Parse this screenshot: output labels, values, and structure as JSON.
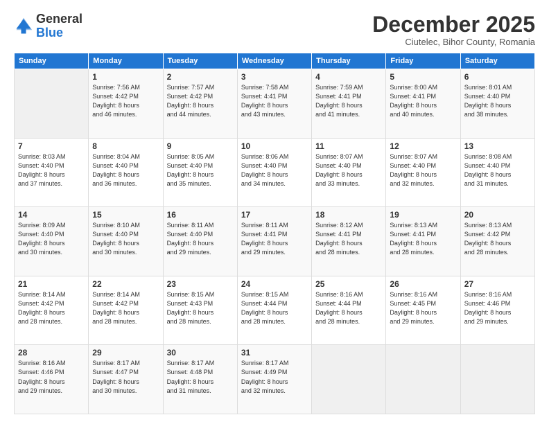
{
  "header": {
    "logo_general": "General",
    "logo_blue": "Blue",
    "month_title": "December 2025",
    "location": "Ciutelec, Bihor County, Romania"
  },
  "days_of_week": [
    "Sunday",
    "Monday",
    "Tuesday",
    "Wednesday",
    "Thursday",
    "Friday",
    "Saturday"
  ],
  "weeks": [
    [
      {
        "day": "",
        "info": ""
      },
      {
        "day": "1",
        "info": "Sunrise: 7:56 AM\nSunset: 4:42 PM\nDaylight: 8 hours\nand 46 minutes."
      },
      {
        "day": "2",
        "info": "Sunrise: 7:57 AM\nSunset: 4:42 PM\nDaylight: 8 hours\nand 44 minutes."
      },
      {
        "day": "3",
        "info": "Sunrise: 7:58 AM\nSunset: 4:41 PM\nDaylight: 8 hours\nand 43 minutes."
      },
      {
        "day": "4",
        "info": "Sunrise: 7:59 AM\nSunset: 4:41 PM\nDaylight: 8 hours\nand 41 minutes."
      },
      {
        "day": "5",
        "info": "Sunrise: 8:00 AM\nSunset: 4:41 PM\nDaylight: 8 hours\nand 40 minutes."
      },
      {
        "day": "6",
        "info": "Sunrise: 8:01 AM\nSunset: 4:40 PM\nDaylight: 8 hours\nand 38 minutes."
      }
    ],
    [
      {
        "day": "7",
        "info": "Sunrise: 8:03 AM\nSunset: 4:40 PM\nDaylight: 8 hours\nand 37 minutes."
      },
      {
        "day": "8",
        "info": "Sunrise: 8:04 AM\nSunset: 4:40 PM\nDaylight: 8 hours\nand 36 minutes."
      },
      {
        "day": "9",
        "info": "Sunrise: 8:05 AM\nSunset: 4:40 PM\nDaylight: 8 hours\nand 35 minutes."
      },
      {
        "day": "10",
        "info": "Sunrise: 8:06 AM\nSunset: 4:40 PM\nDaylight: 8 hours\nand 34 minutes."
      },
      {
        "day": "11",
        "info": "Sunrise: 8:07 AM\nSunset: 4:40 PM\nDaylight: 8 hours\nand 33 minutes."
      },
      {
        "day": "12",
        "info": "Sunrise: 8:07 AM\nSunset: 4:40 PM\nDaylight: 8 hours\nand 32 minutes."
      },
      {
        "day": "13",
        "info": "Sunrise: 8:08 AM\nSunset: 4:40 PM\nDaylight: 8 hours\nand 31 minutes."
      }
    ],
    [
      {
        "day": "14",
        "info": "Sunrise: 8:09 AM\nSunset: 4:40 PM\nDaylight: 8 hours\nand 30 minutes."
      },
      {
        "day": "15",
        "info": "Sunrise: 8:10 AM\nSunset: 4:40 PM\nDaylight: 8 hours\nand 30 minutes."
      },
      {
        "day": "16",
        "info": "Sunrise: 8:11 AM\nSunset: 4:40 PM\nDaylight: 8 hours\nand 29 minutes."
      },
      {
        "day": "17",
        "info": "Sunrise: 8:11 AM\nSunset: 4:41 PM\nDaylight: 8 hours\nand 29 minutes."
      },
      {
        "day": "18",
        "info": "Sunrise: 8:12 AM\nSunset: 4:41 PM\nDaylight: 8 hours\nand 28 minutes."
      },
      {
        "day": "19",
        "info": "Sunrise: 8:13 AM\nSunset: 4:41 PM\nDaylight: 8 hours\nand 28 minutes."
      },
      {
        "day": "20",
        "info": "Sunrise: 8:13 AM\nSunset: 4:42 PM\nDaylight: 8 hours\nand 28 minutes."
      }
    ],
    [
      {
        "day": "21",
        "info": "Sunrise: 8:14 AM\nSunset: 4:42 PM\nDaylight: 8 hours\nand 28 minutes."
      },
      {
        "day": "22",
        "info": "Sunrise: 8:14 AM\nSunset: 4:42 PM\nDaylight: 8 hours\nand 28 minutes."
      },
      {
        "day": "23",
        "info": "Sunrise: 8:15 AM\nSunset: 4:43 PM\nDaylight: 8 hours\nand 28 minutes."
      },
      {
        "day": "24",
        "info": "Sunrise: 8:15 AM\nSunset: 4:44 PM\nDaylight: 8 hours\nand 28 minutes."
      },
      {
        "day": "25",
        "info": "Sunrise: 8:16 AM\nSunset: 4:44 PM\nDaylight: 8 hours\nand 28 minutes."
      },
      {
        "day": "26",
        "info": "Sunrise: 8:16 AM\nSunset: 4:45 PM\nDaylight: 8 hours\nand 29 minutes."
      },
      {
        "day": "27",
        "info": "Sunrise: 8:16 AM\nSunset: 4:46 PM\nDaylight: 8 hours\nand 29 minutes."
      }
    ],
    [
      {
        "day": "28",
        "info": "Sunrise: 8:16 AM\nSunset: 4:46 PM\nDaylight: 8 hours\nand 29 minutes."
      },
      {
        "day": "29",
        "info": "Sunrise: 8:17 AM\nSunset: 4:47 PM\nDaylight: 8 hours\nand 30 minutes."
      },
      {
        "day": "30",
        "info": "Sunrise: 8:17 AM\nSunset: 4:48 PM\nDaylight: 8 hours\nand 31 minutes."
      },
      {
        "day": "31",
        "info": "Sunrise: 8:17 AM\nSunset: 4:49 PM\nDaylight: 8 hours\nand 32 minutes."
      },
      {
        "day": "",
        "info": ""
      },
      {
        "day": "",
        "info": ""
      },
      {
        "day": "",
        "info": ""
      }
    ]
  ]
}
